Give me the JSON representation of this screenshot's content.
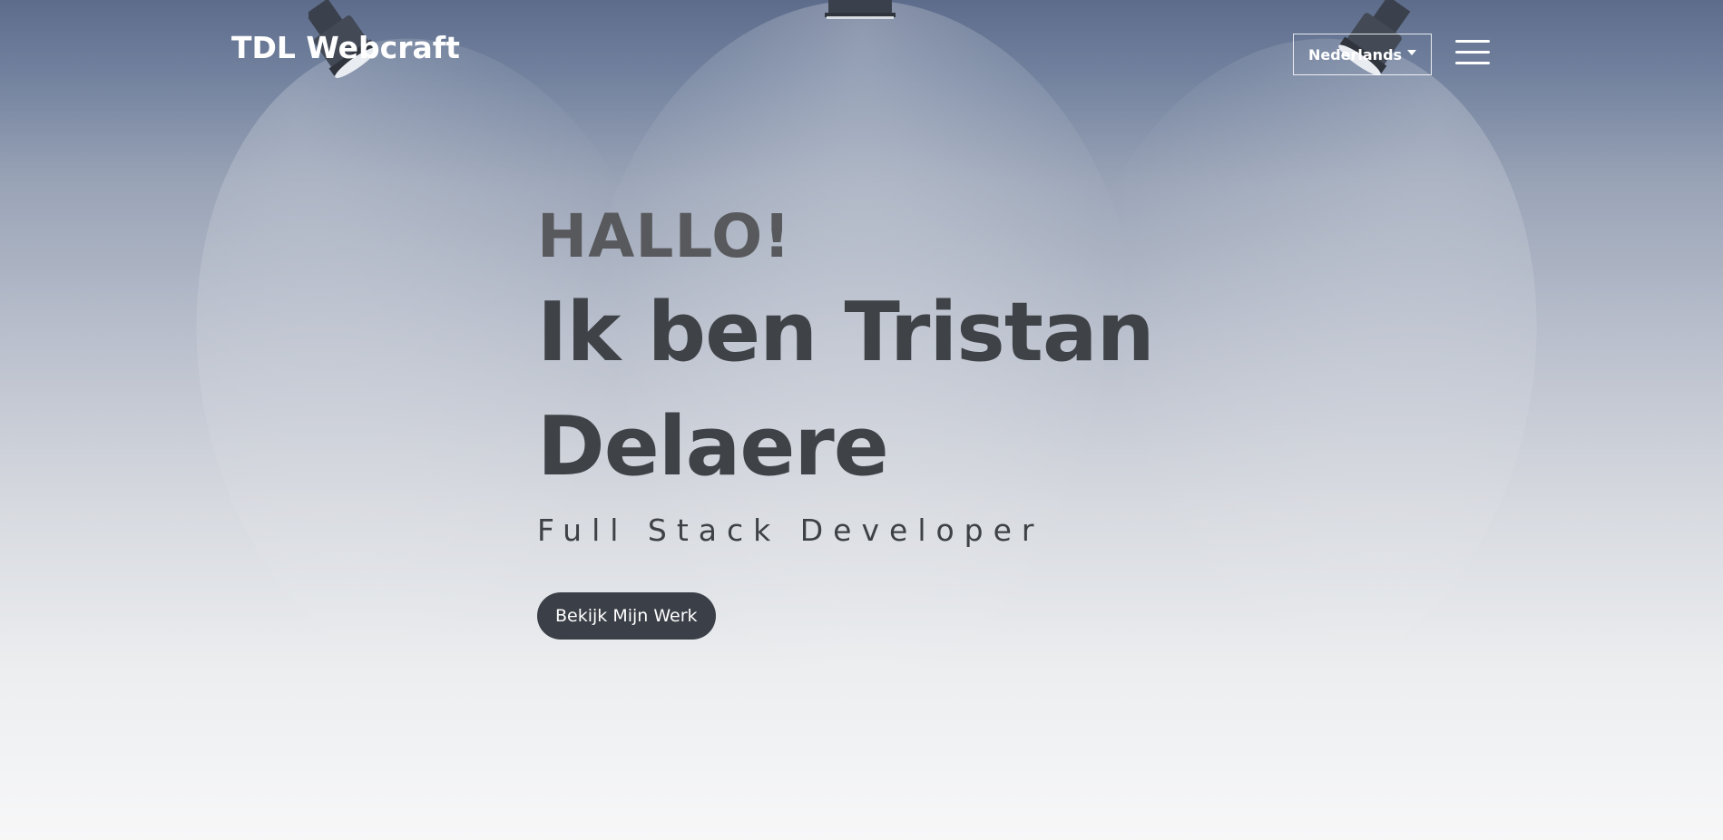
{
  "header": {
    "brand": "TDL Webcraft",
    "language_label": "Nederlands"
  },
  "hero": {
    "greeting": "HALLO!",
    "name_line1": "Ik ben Tristan",
    "name_line2": "Delaere",
    "subtitle": "Full Stack Developer",
    "cta_label": "Bekijk Mijn Werk"
  },
  "icons": {
    "menu": "hamburger-menu-icon",
    "dropdown": "caret-down-icon",
    "decor": "spotlight-lamp"
  },
  "colors": {
    "cta_background": "#3b3f47",
    "headline": "#3f4348",
    "greeting": "#58595c",
    "nav_text": "#ffffff"
  }
}
